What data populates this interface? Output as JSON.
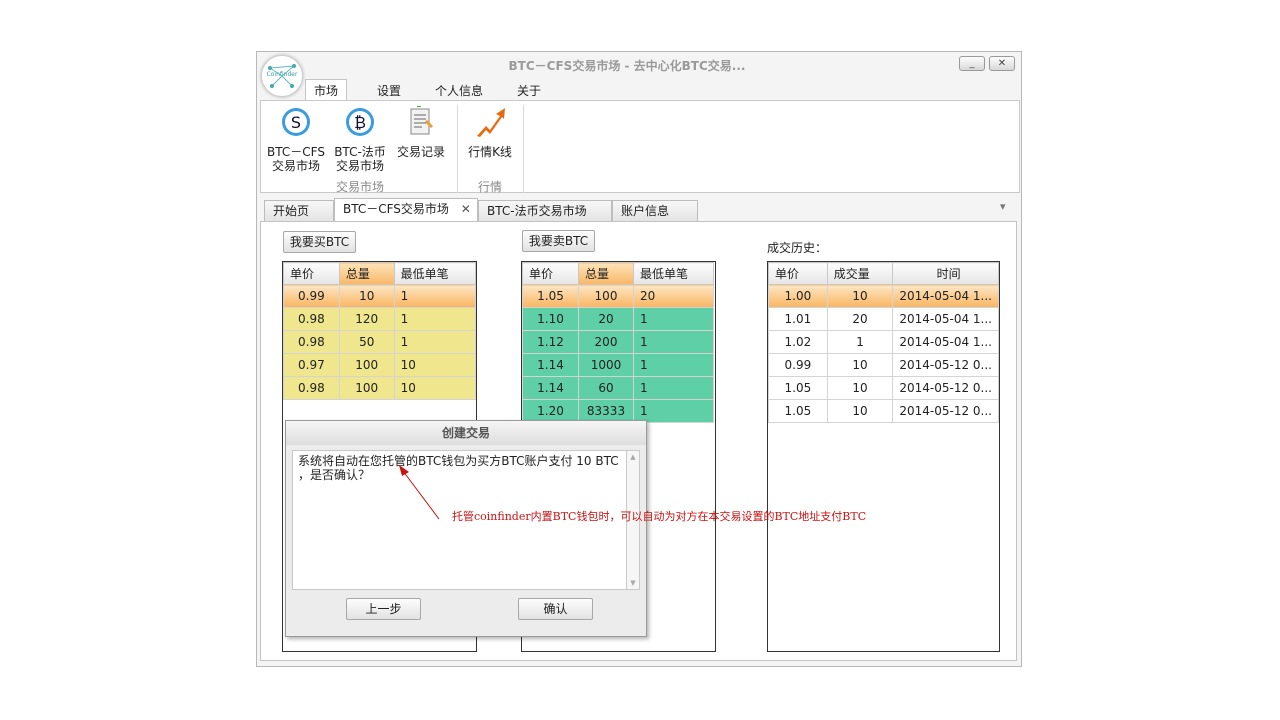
{
  "window": {
    "title": "BTC－CFS交易市场 - 去中心化BTC交易...",
    "logo_text": "Coinfinder",
    "minimize": "_",
    "close": "✕"
  },
  "ribbon_tabs": [
    "市场",
    "设置",
    "个人信息",
    "关于"
  ],
  "ribbon": {
    "btn_btc_cfs": [
      "BTC－CFS",
      "交易市场"
    ],
    "btn_btc_fiat": [
      "BTC-法币",
      "交易市场"
    ],
    "btn_records": "交易记录",
    "btn_kline": "行情K线",
    "group_market": "交易市场",
    "group_quote": "行情"
  },
  "doc_tabs": [
    "开始页",
    "BTC－CFS交易市场",
    "BTC-法币交易市场",
    "账户信息"
  ],
  "doc_tab_close": "✕",
  "doc_tab_menu": "▾",
  "buy_button": "我要买BTC",
  "sell_button": "我要卖BTC",
  "history_label": "成交历史：",
  "buy_table": {
    "headers": [
      "单价",
      "总量",
      "最低单笔"
    ],
    "rows": [
      [
        "0.99",
        "10",
        "1"
      ],
      [
        "0.98",
        "120",
        "1"
      ],
      [
        "0.98",
        "50",
        "1"
      ],
      [
        "0.97",
        "100",
        "10"
      ],
      [
        "0.98",
        "100",
        "10"
      ]
    ]
  },
  "sell_table": {
    "headers": [
      "单价",
      "总量",
      "最低单笔"
    ],
    "rows": [
      [
        "1.05",
        "100",
        "20"
      ],
      [
        "1.10",
        "20",
        "1"
      ],
      [
        "1.12",
        "200",
        "1"
      ],
      [
        "1.14",
        "1000",
        "1"
      ],
      [
        "1.14",
        "60",
        "1"
      ],
      [
        "1.20",
        "83333",
        "1"
      ]
    ]
  },
  "history_table": {
    "headers": [
      "单价",
      "成交量",
      "时间"
    ],
    "rows": [
      [
        "1.00",
        "10",
        "2014-05-04 1..."
      ],
      [
        "1.01",
        "20",
        "2014-05-04 1..."
      ],
      [
        "1.02",
        "1",
        "2014-05-04 1..."
      ],
      [
        "0.99",
        "10",
        "2014-05-12 0..."
      ],
      [
        "1.05",
        "10",
        "2014-05-12 0..."
      ],
      [
        "1.05",
        "10",
        "2014-05-12 0..."
      ]
    ]
  },
  "dialog": {
    "title": "创建交易",
    "message_line1": "系统将自动在您托管的BTC钱包为买方BTC账户支付 10 BTC",
    "message_line2": "，是否确认？",
    "back_button": "上一步",
    "confirm_button": "确认"
  },
  "annotation": "托管coinfinder内置BTC钱包时，可以自动为对方在本交易设置的BTC地址支付BTC",
  "colors": {
    "annotation": "#cc1111",
    "buy_rows": "#efe68d",
    "sell_rows": "#5fcfa8",
    "selected_row": "#f9b560"
  }
}
